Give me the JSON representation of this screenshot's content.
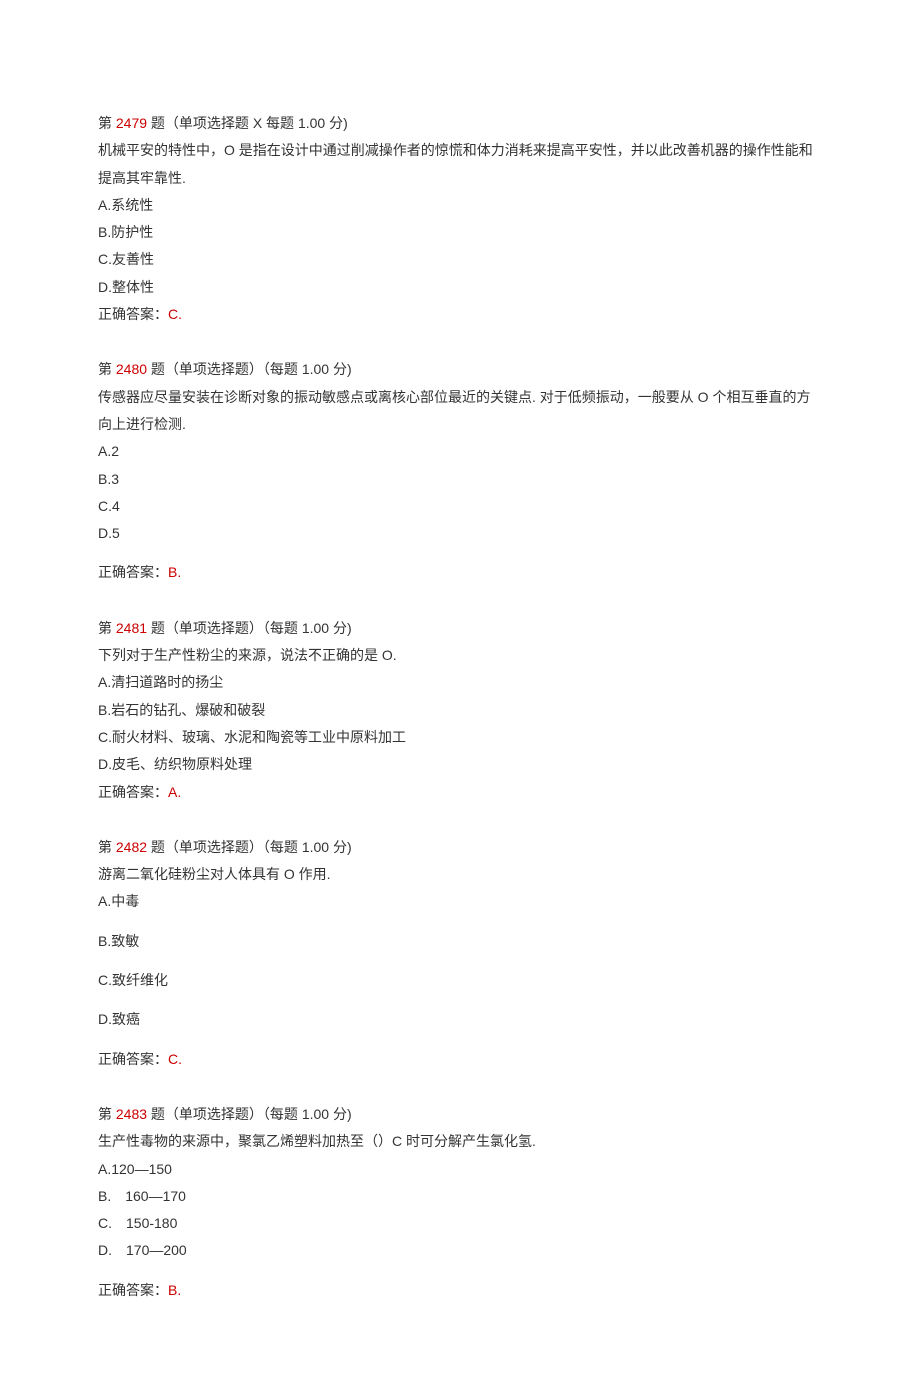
{
  "questions": [
    {
      "prefix": "第 ",
      "number": "2479",
      "header_rest": " 题（单项选择题 X 每题 1.00 分)",
      "stem": "机械平安的特性中，O 是指在设计中通过削减操作者的惊慌和体力消耗来提高平安性，并以此改善机器的操作性能和提高其牢靠性.",
      "options": [
        "A.系统性",
        "B.防护性",
        "C.友善性",
        "D.整体性"
      ],
      "answer_label": "正确答案：",
      "answer_value": "C.",
      "spaced": false,
      "indent": false
    },
    {
      "prefix": "第 ",
      "number": "2480",
      "header_rest": " 题（单项选择题）（每题 1.00 分)",
      "stem": "传感器应尽量安装在诊断对象的振动敏感点或离核心部位最近的关键点. 对于低频振动，一般要从 O 个相互垂直的方向上进行检测.",
      "options": [
        "A.2",
        "B.3",
        "C.4",
        "D.5"
      ],
      "answer_label": "正确答案：",
      "answer_value": "B.",
      "spaced": false,
      "indent": false,
      "gap_before_answer": true
    },
    {
      "prefix": "第 ",
      "number": "2481",
      "header_rest": " 题（单项选择题）（每题 1.00 分)",
      "stem": "下列对于生产性粉尘的来源，说法不正确的是 O.",
      "options": [
        "A.清扫道路时的扬尘",
        "B.岩石的钻孔、爆破和破裂",
        "C.耐火材料、玻璃、水泥和陶瓷等工业中原料加工",
        "D.皮毛、纺织物原料处理"
      ],
      "answer_label": "正确答案：",
      "answer_value": "A.",
      "spaced": false,
      "indent": false
    },
    {
      "prefix": "第 ",
      "number": "2482",
      "header_rest": " 题（单项选择题）（每题 1.00 分)",
      "stem": "游离二氧化硅粉尘对人体具有 O 作用.",
      "options": [
        "A.中毒",
        "B.致敏",
        "C.致纤维化",
        "D.致癌"
      ],
      "answer_label": "正确答案：",
      "answer_value": "C.",
      "spaced": true,
      "indent": false
    },
    {
      "prefix": "第 ",
      "number": "2483",
      "header_rest": " 题（单项选择题）（每题 1.00 分)",
      "stem": "生产性毒物的来源中，聚氯乙烯塑料加热至（）C 时可分解产生氯化氢.",
      "options": [
        "A.120—150",
        "B.　160—170",
        "C.　150-180",
        "D.　170—200"
      ],
      "answer_label": "正确答案：",
      "answer_value": "B.",
      "spaced": false,
      "indent": true,
      "gap_before_answer": true
    }
  ]
}
